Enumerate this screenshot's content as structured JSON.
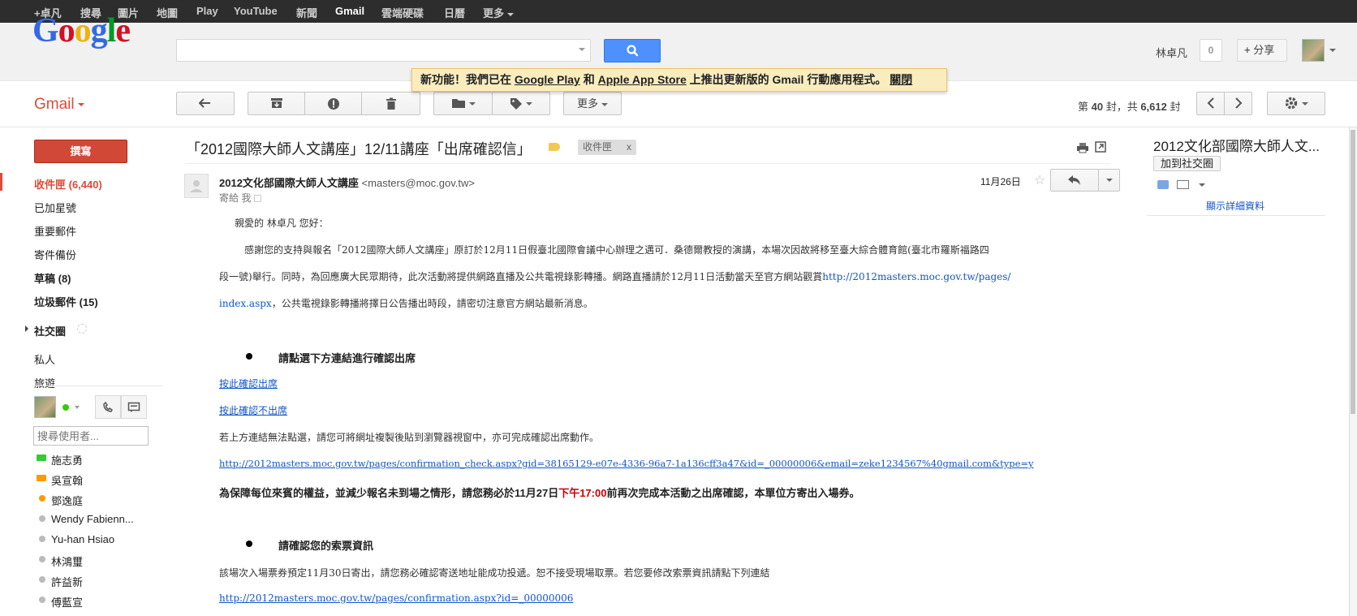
{
  "topbar": {
    "items": [
      "+卓凡",
      "搜尋",
      "圖片",
      "地圖",
      "Play",
      "YouTube",
      "新聞",
      "Gmail",
      "雲端硬碟",
      "日曆",
      "更多"
    ]
  },
  "header": {
    "logo": "Google",
    "search_value": "",
    "user_name": "林卓凡",
    "notification_count": "0",
    "share_label": "分享"
  },
  "banner": {
    "prefix": "新功能！我們已在 ",
    "google_play": "Google Play",
    "and": " 和 ",
    "app_store": "Apple App Store",
    "suffix": " 上推出更新版的 Gmail 行動應用程式。 ",
    "close": "關閉"
  },
  "toolbar": {
    "gmail_label": "Gmail",
    "more_label": "更多",
    "pager": {
      "prefix": "第 ",
      "current": "40",
      "middle": " 封，共 ",
      "total": "6,612",
      "suffix": " 封"
    }
  },
  "sidebar": {
    "compose": "撰寫",
    "items": [
      {
        "label": "收件匣 (6,440)"
      },
      {
        "label": "已加星號"
      },
      {
        "label": "重要郵件"
      },
      {
        "label": "寄件備份"
      },
      {
        "label": "草稿 (8)"
      },
      {
        "label": "垃圾郵件 (15)"
      }
    ],
    "circles_label": "社交圈",
    "circles": [
      {
        "label": "私人"
      },
      {
        "label": "旅遊"
      }
    ],
    "chat_search_placeholder": "搜尋使用者...",
    "contacts": [
      {
        "name": "施志勇",
        "status": "video"
      },
      {
        "name": "吳宣翰",
        "status": "video-orange"
      },
      {
        "name": "鄧逸庭",
        "status": "away"
      },
      {
        "name": "Wendy Fabienn...",
        "status": "offline"
      },
      {
        "name": "Yu-han Hsiao",
        "status": "offline"
      },
      {
        "name": "林鴻璽",
        "status": "offline"
      },
      {
        "name": "許益新",
        "status": "offline"
      },
      {
        "name": "傅藍宣",
        "status": "offline"
      }
    ]
  },
  "message": {
    "subject": "「2012國際大師人文講座」12/11講座「出席確認信」",
    "label_chip": "收件匣",
    "label_chip_close": "x",
    "sender_name": "2012文化部國際大師人文講座",
    "sender_email": "<masters@moc.gov.tw>",
    "sent_to": "寄給 我",
    "date": "11月26日",
    "body": {
      "greeting": "親愛的 林卓凡 您好：",
      "para1_line1": "感謝您的支持與報名「2012國際大師人文講座」原訂於12月11日假臺北國際會議中心辦理之邁可．桑德爾教授的演講，本場次因故將移至臺大綜合體育館(臺北市羅斯福路四",
      "para1_line2": "段一號)舉行。同時，為回應廣大民眾期待，此次活動將提供網路直播及公共電視錄影轉播。網路直播請於12月11日活動當天至官方網站觀賞",
      "para1_link_a": "http://2012masters.moc.gov.tw/pages/",
      "para1_link_b": "index.aspx",
      "para1_line3": "，公共電視錄影轉播將擇日公告播出時段，請密切注意官方網站最新消息。",
      "section1_heading": "請點選下方連結進行確認出席",
      "link_attend": "按此確認出席",
      "link_not_attend": "按此確認不出席",
      "copy_hint": "若上方連結無法點選，請您可將網址複製後貼到瀏覽器視窗中，亦可完成確認出席動作。",
      "confirm_url": "http://2012masters.moc.gov.tw/pages/confirmation_check.aspx?gid=38165129-e07e-4336-96a7-1a136cff3a47&id=_00000006&email=zeke1234567%40gmail.com&type=y",
      "deadline_pre": "為保障每位來賓的權益，並減少報名未到場之情形，請您務必於11月27日",
      "deadline_time": "下午17:00",
      "deadline_post": "前再次完成本活動之出席確認，本單位方寄出入場券。",
      "section2_heading": "請確認您的索票資訊",
      "ticket_text": "該場次入場票券預定11月30日寄出，請您務必確認寄送地址能成功投遞。恕不接受現場取票。若您要修改索票資訊請點下列連結",
      "ticket_url": "http://2012masters.moc.gov.tw/pages/confirmation.aspx?id=_00000006"
    }
  },
  "right_panel": {
    "title": "2012文化部國際大師人文...",
    "add_circle": "加到社交圈",
    "show_details": "顯示詳細資料"
  },
  "colors": {
    "gmail_red": "#dd4b39",
    "compose_red": "#d14836",
    "search_blue": "#4d90fe",
    "link_blue": "#1155cc",
    "banner_bg": "#f9edbe",
    "topbar_bg": "#2d2d2d",
    "deadline_red": "#cc0000"
  },
  "icons": [
    "search-icon",
    "reply-icon",
    "archive-icon",
    "spam-icon",
    "trash-icon",
    "folder-icon",
    "label-icon",
    "chevron-left-icon",
    "chevron-right-icon",
    "gear-icon",
    "print-icon",
    "new-window-icon",
    "star-icon",
    "phone-icon",
    "video-chat-icon"
  ]
}
